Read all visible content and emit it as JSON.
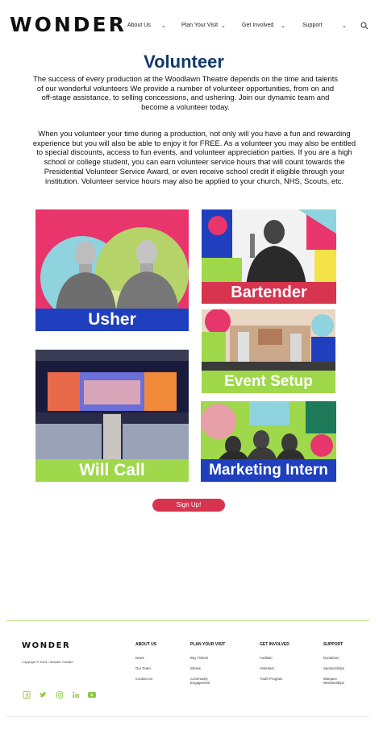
{
  "header": {
    "logo": "WONDER",
    "nav": [
      {
        "label": "About Us"
      },
      {
        "label": "Plan Your Visit"
      },
      {
        "label": "Get Involved"
      },
      {
        "label": "Support"
      }
    ]
  },
  "main": {
    "title": "Volunteer",
    "intro": "The success of every production at the Woodlawn Theatre depends on the time and talents of our wonderful volunteers We provide a number of volunteer opportunities, from on and off-stage assistance, to selling concessions, and ushering. Join our dynamic team and become a volunteer today.",
    "details": "When you volunteer your time during a production, not only will you have a fun and rewarding experience but you will also be able to enjoy it for FREE. As a volunteer you may also be entitled to special discounts, access to fun events, and volunteer appreciation parties. If you are a high school or college student, you can earn volunteer service hours that will count towards the Presidential Volunteer Service Award, or even receive school credit if eligible through your institution. Volunteer service hours may also be applied to your church, NHS, Scouts, etc.",
    "tiles": [
      {
        "label": "Usher",
        "label_bg": "#1f3fbf"
      },
      {
        "label": "Bartender",
        "label_bg": "#d7344f"
      },
      {
        "label": "Event Setup",
        "label_bg": "#9fd84a"
      },
      {
        "label": "Will Call",
        "label_bg": "#9fd84a"
      },
      {
        "label": "Marketing Intern",
        "label_bg": "#1f3fbf"
      }
    ],
    "signup_label": "Sign Up!"
  },
  "footer": {
    "logo": "WONDER",
    "copyright": "Copyright © 2023 • Wonder Theatre",
    "columns": [
      {
        "heading": "ABOUT US",
        "links": [
          "News",
          "Our Team",
          "Contact Us"
        ]
      },
      {
        "heading": "PLAN YOUR VISIT",
        "links": [
          "Buy Tickets",
          "Shows",
          "Community Engagement"
        ]
      },
      {
        "heading": "GET INVOLVED",
        "links": [
          "Audition",
          "Volunteer",
          "Youth Program"
        ]
      },
      {
        "heading": "SUPPORT",
        "links": [
          "Donations",
          "Sponsorships",
          "Marquee Memberships"
        ]
      }
    ],
    "social_icons": [
      "facebook-icon",
      "twitter-icon",
      "instagram-icon",
      "linkedin-icon",
      "youtube-icon"
    ],
    "accent": "#8cc63f"
  }
}
